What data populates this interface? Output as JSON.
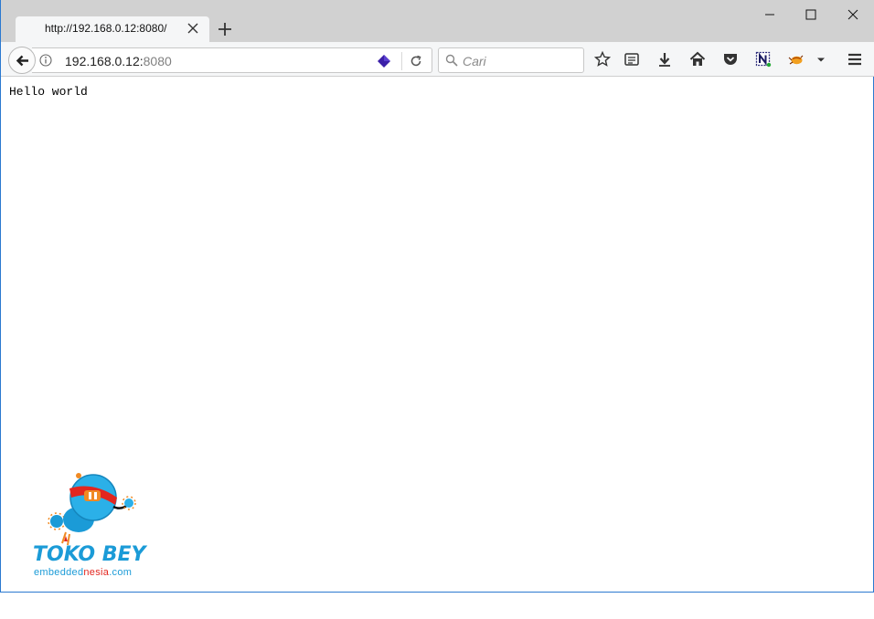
{
  "browser": {
    "tab": {
      "title": "http://192.168.0.12:8080/"
    },
    "url": {
      "host": "192.168.0.12:",
      "port": "8080"
    },
    "search": {
      "placeholder": "Cari"
    },
    "toolbar_icons": [
      "star-icon",
      "reading-list-icon",
      "download-icon",
      "home-icon",
      "pocket-icon",
      "n-extension-icon",
      "firebug-icon",
      "overflow-menu-icon",
      "hamburger-menu-icon"
    ],
    "colors": {
      "chrome": "#d1d1d1",
      "toolbar": "#f5f6f7",
      "window_border": "#2b79d0"
    }
  },
  "page": {
    "body_text": "Hello world"
  },
  "watermark": {
    "brand": "TOKO BEY",
    "site_prefix": "embedded",
    "site_accent": "nesia",
    "site_suffix": ".com",
    "colors": {
      "blue": "#1b9bd7",
      "red": "#e2261f",
      "orange": "#f08a24"
    }
  }
}
